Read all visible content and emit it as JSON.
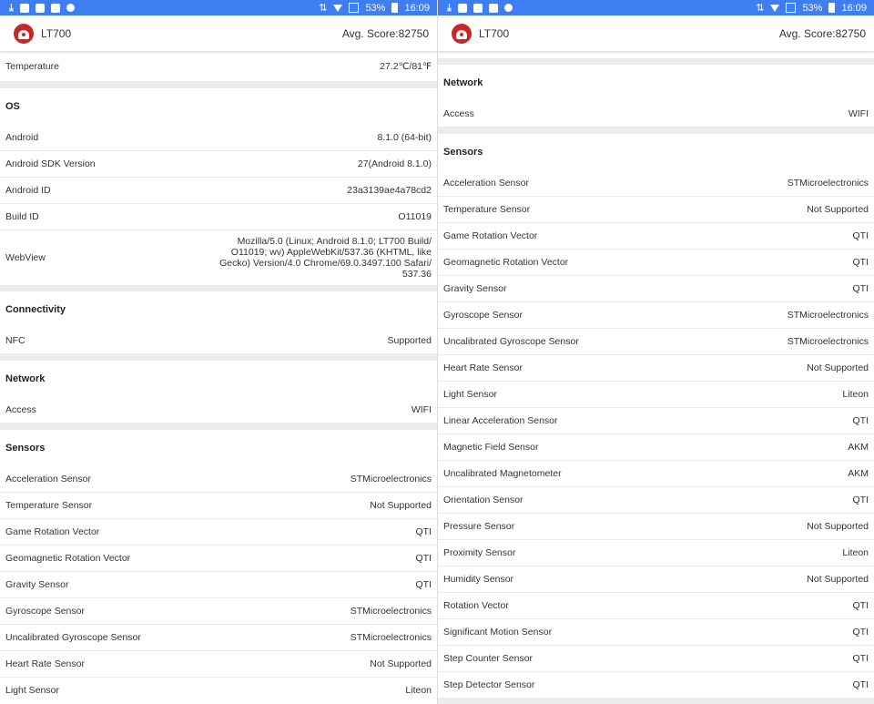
{
  "status": {
    "battery": "53%",
    "time": "16:09"
  },
  "appbar": {
    "device": "LT700",
    "score": "Avg. Score:82750"
  },
  "left": {
    "top_row": {
      "label": "Temperature",
      "value": "27.2℃/81℉"
    },
    "os": {
      "title": "OS",
      "rows": [
        {
          "label": "Android",
          "value": "8.1.0 (64-bit)"
        },
        {
          "label": "Android SDK Version",
          "value": "27(Android 8.1.0)"
        },
        {
          "label": "Android ID",
          "value": "23a3139ae4a78cd2"
        },
        {
          "label": "Build ID",
          "value": "O11019"
        },
        {
          "label": "WebView",
          "value": "Mozilla/5.0 (Linux; Android 8.1.0; LT700 Build/ O11019; wv) AppleWebKit/537.36 (KHTML, like Gecko) Version/4.0 Chrome/69.0.3497.100 Safari/ 537.36"
        }
      ]
    },
    "connectivity": {
      "title": "Connectivity",
      "rows": [
        {
          "label": "NFC",
          "value": "Supported"
        }
      ]
    },
    "network": {
      "title": "Network",
      "rows": [
        {
          "label": "Access",
          "value": "WIFI"
        }
      ]
    },
    "sensors": {
      "title": "Sensors",
      "rows": [
        {
          "label": "Acceleration Sensor",
          "value": "STMicroelectronics"
        },
        {
          "label": "Temperature Sensor",
          "value": "Not Supported"
        },
        {
          "label": "Game Rotation Vector",
          "value": "QTI"
        },
        {
          "label": "Geomagnetic Rotation Vector",
          "value": "QTI"
        },
        {
          "label": "Gravity Sensor",
          "value": "QTI"
        },
        {
          "label": "Gyroscope Sensor",
          "value": "STMicroelectronics"
        },
        {
          "label": "Uncalibrated Gyroscope Sensor",
          "value": "STMicroelectronics"
        },
        {
          "label": "Heart Rate Sensor",
          "value": "Not Supported"
        },
        {
          "label": "Light Sensor",
          "value": "Liteon"
        }
      ]
    }
  },
  "right": {
    "network": {
      "title": "Network",
      "rows": [
        {
          "label": "Access",
          "value": "WIFI"
        }
      ]
    },
    "sensors": {
      "title": "Sensors",
      "rows": [
        {
          "label": "Acceleration Sensor",
          "value": "STMicroelectronics"
        },
        {
          "label": "Temperature Sensor",
          "value": "Not Supported"
        },
        {
          "label": "Game Rotation Vector",
          "value": "QTI"
        },
        {
          "label": "Geomagnetic Rotation Vector",
          "value": "QTI"
        },
        {
          "label": "Gravity Sensor",
          "value": "QTI"
        },
        {
          "label": "Gyroscope Sensor",
          "value": "STMicroelectronics"
        },
        {
          "label": "Uncalibrated Gyroscope Sensor",
          "value": "STMicroelectronics"
        },
        {
          "label": "Heart Rate Sensor",
          "value": "Not Supported"
        },
        {
          "label": "Light Sensor",
          "value": "Liteon"
        },
        {
          "label": "Linear Acceleration Sensor",
          "value": "QTI"
        },
        {
          "label": "Magnetic Field Sensor",
          "value": "AKM"
        },
        {
          "label": "Uncalibrated Magnetometer",
          "value": "AKM"
        },
        {
          "label": "Orientation Sensor",
          "value": "QTI"
        },
        {
          "label": "Pressure Sensor",
          "value": "Not Supported"
        },
        {
          "label": "Proximity Sensor",
          "value": "Liteon"
        },
        {
          "label": "Humidity Sensor",
          "value": "Not Supported"
        },
        {
          "label": "Rotation Vector",
          "value": "QTI"
        },
        {
          "label": "Significant Motion Sensor",
          "value": "QTI"
        },
        {
          "label": "Step Counter Sensor",
          "value": "QTI"
        },
        {
          "label": "Step Detector Sensor",
          "value": "QTI"
        }
      ]
    }
  },
  "icons": [
    "download-icon",
    "notification-icon",
    "wifi-icon",
    "signal-icon",
    "battery-icon",
    "app-logo-icon"
  ],
  "colors": {
    "statusbar": "#3f7df3",
    "logo": "#c62828",
    "divider": "#ececec"
  }
}
